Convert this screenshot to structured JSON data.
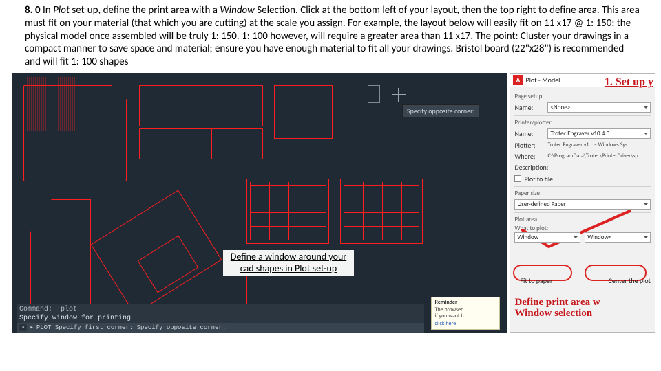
{
  "instruction": {
    "step": "8. 0",
    "lead": " In ",
    "plot_word": "Plot",
    "after_plot": " set-up, define the print area with a ",
    "window_word": "Window",
    "body": " Selection. Click at the bottom left of your layout, then the top right to define area. This area must fit on your material (that which you are cutting) at the scale you assign. For example, the layout below will easily fit on 11 x17 @ 1: 150; the physical model once assembled will be truly 1: 150. 1: 100 however, will require a greater area than 11 x17. The point: Cluster your drawings in a compact manner to save space and material; ensure you have enough material to fit all your drawings. Bristol board (22\"x28\") is recommended and will fit 1: 100 shapes"
  },
  "cad": {
    "tooltip": "Specify opposite corner:",
    "annotation": "Define a window around your cad shapes in Plot set-up",
    "cli_line1": "Command: _plot",
    "cli_line2": "Specify window for printing",
    "prompt_chip": "×",
    "prompt_text": "PLOT Specify first corner:  Specify opposite corner:",
    "reminder_title": "Reminder",
    "reminder_body": "The browser…",
    "reminder_body2": "if you want to",
    "reminder_link": "click here"
  },
  "plot": {
    "title": "Plot - Model",
    "scribble_top": "1. Set up y",
    "page_setup_label": "Page setup",
    "name_label": "Name:",
    "name_value": "<None>",
    "printer_label": "Printer/plotter",
    "printer_name_label": "Name:",
    "printer_name_value": "Trotec Engraver v10.4.0",
    "plotter_label": "Plotter:",
    "plotter_value": "Trotec Engraver v1… – Windows Sys",
    "where_label": "Where:",
    "where_value": "C:\\ProgramData\\Trotec\\PrinterDriver\\sp",
    "desc_label": "Description:",
    "plot_to_file": "Plot to file",
    "paper_label": "Paper size",
    "paper_value": "User-defined Paper",
    "plot_area_label": "Plot area",
    "what_label": "What to plot:",
    "what_value": "Window",
    "window_btn": "Window<",
    "fit": "Fit to paper",
    "center": "Center the plot",
    "scribble_l1": "Define print area w",
    "scribble_l2": "Window selection"
  }
}
